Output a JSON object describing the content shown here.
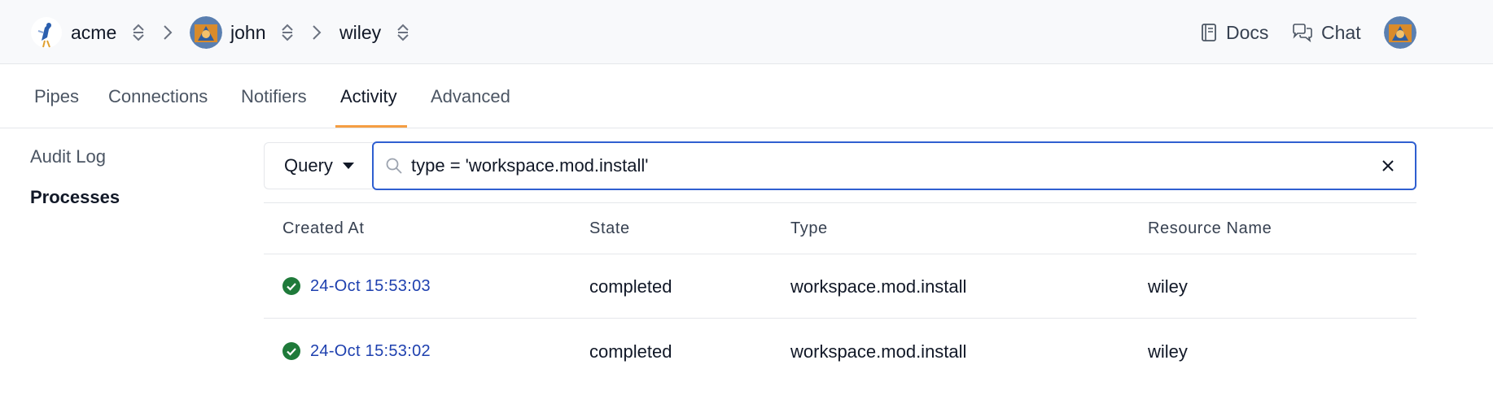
{
  "breadcrumb": {
    "org": "acme",
    "user": "john",
    "workspace": "wiley"
  },
  "header": {
    "docs_label": "Docs",
    "chat_label": "Chat"
  },
  "tabs": [
    {
      "label": "Pipes"
    },
    {
      "label": "Connections"
    },
    {
      "label": "Notifiers"
    },
    {
      "label": "Activity",
      "active": true
    },
    {
      "label": "Advanced"
    }
  ],
  "sidebar": {
    "items": [
      {
        "label": "Audit Log"
      },
      {
        "label": "Processes",
        "active": true
      }
    ]
  },
  "query": {
    "mode_label": "Query",
    "value": "type = 'workspace.mod.install'"
  },
  "table": {
    "columns": [
      "Created At",
      "State",
      "Type",
      "Resource Name"
    ],
    "rows": [
      {
        "created_at": "24-Oct 15:53:03",
        "state": "completed",
        "type": "workspace.mod.install",
        "resource": "wiley",
        "status_icon": "check-circle-icon"
      },
      {
        "created_at": "24-Oct 15:53:02",
        "state": "completed",
        "type": "workspace.mod.install",
        "resource": "wiley",
        "status_icon": "check-circle-icon"
      }
    ]
  },
  "colors": {
    "accent_tab": "#f59e42",
    "focus_border": "#2f5fd0",
    "link": "#1e40af",
    "success": "#1f7a3a"
  }
}
